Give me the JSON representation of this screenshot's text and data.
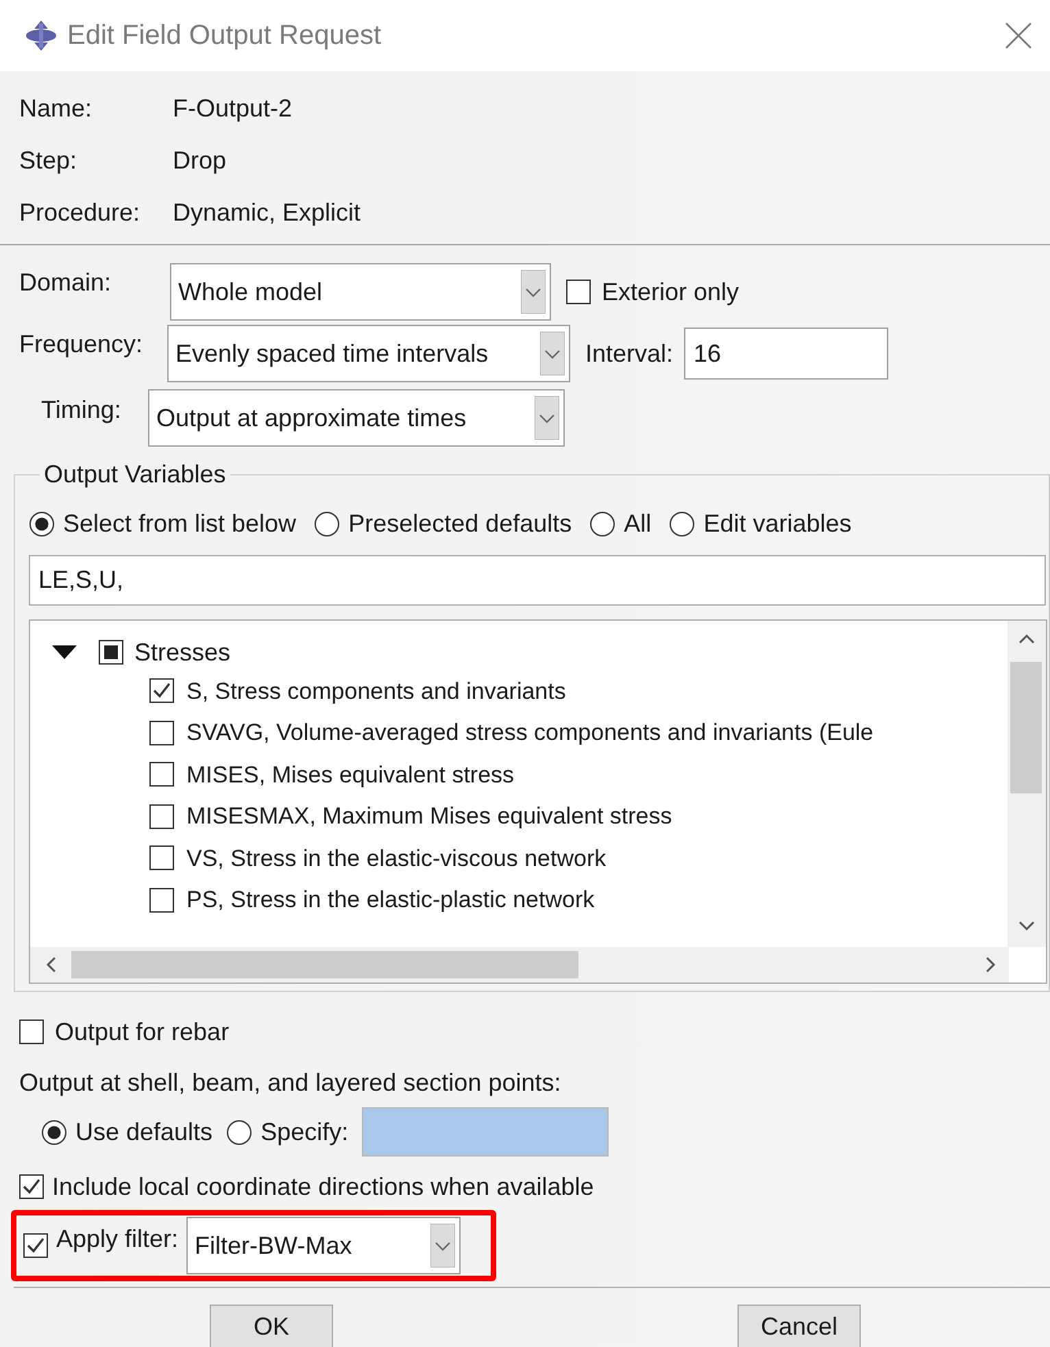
{
  "window": {
    "title": "Edit Field Output Request"
  },
  "info": [
    {
      "label": "Name:",
      "value": "F-Output-2"
    },
    {
      "label": "Step:",
      "value": "Drop"
    },
    {
      "label": "Procedure:",
      "value": "Dynamic, Explicit"
    }
  ],
  "domain": {
    "label": "Domain:",
    "value": "Whole model",
    "exterior_only": {
      "label": "Exterior only",
      "checked": false
    }
  },
  "frequency": {
    "label": "Frequency:",
    "value": "Evenly spaced time intervals",
    "interval": {
      "label": "Interval:",
      "value": "16"
    }
  },
  "timing": {
    "label": "Timing:",
    "value": "Output at approximate times"
  },
  "output_variables": {
    "title": "Output Variables",
    "options": [
      {
        "label": "Select from list below",
        "selected": true
      },
      {
        "label": "Preselected defaults",
        "selected": false
      },
      {
        "label": "All",
        "selected": false
      },
      {
        "label": "Edit variables",
        "selected": false
      }
    ],
    "value": "LE,S,U,",
    "tree": [
      {
        "label": "Stresses",
        "expanded": true,
        "partially_checked": true,
        "children": [
          {
            "label": "S, Stress components and invariants",
            "checked": true
          },
          {
            "label": "SVAVG, Volume-averaged stress components and invariants (Eule",
            "checked": false
          },
          {
            "label": "MISES, Mises equivalent stress",
            "checked": false
          },
          {
            "label": "MISESMAX, Maximum Mises equivalent stress",
            "checked": false
          },
          {
            "label": "VS, Stress in the elastic-viscous network",
            "checked": false
          },
          {
            "label": "PS, Stress in the elastic-plastic network",
            "checked": false
          }
        ]
      }
    ]
  },
  "rebar": {
    "label": "Output for rebar",
    "checked": false
  },
  "section_points": {
    "label": "Output at shell, beam, and layered section points:",
    "options": [
      {
        "label": "Use defaults",
        "selected": true
      },
      {
        "label": "Specify:",
        "selected": false
      }
    ]
  },
  "local_directions": {
    "label": "Include local coordinate directions when available",
    "checked": true
  },
  "apply_filter": {
    "label": "Apply filter:",
    "checked": true,
    "value": "Filter-BW-Max",
    "highlighted": true
  },
  "buttons": [
    "OK",
    "Cancel"
  ]
}
